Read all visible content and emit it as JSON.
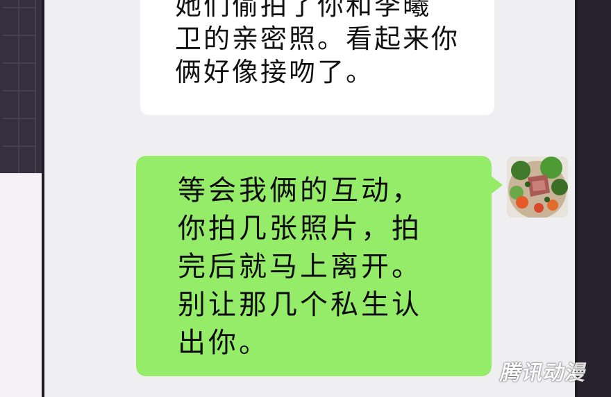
{
  "messages": [
    {
      "sender": "other",
      "text": "她们偷拍了你和李曦\n卫的亲密照。看起来你\n俩好像接吻了。"
    },
    {
      "sender": "self",
      "text": "等会我俩的互动，\n你拍几张照片，拍\n完后就马上离开。\n别让那几个私生认\n出你。"
    }
  ],
  "avatar": {
    "icon": "food-dish-avatar-icon"
  },
  "watermark": {
    "text": "腾讯动漫"
  },
  "colors": {
    "outgoing_bubble": "#95ec69",
    "incoming_bubble": "#ffffff",
    "chat_background": "#efeff1"
  }
}
